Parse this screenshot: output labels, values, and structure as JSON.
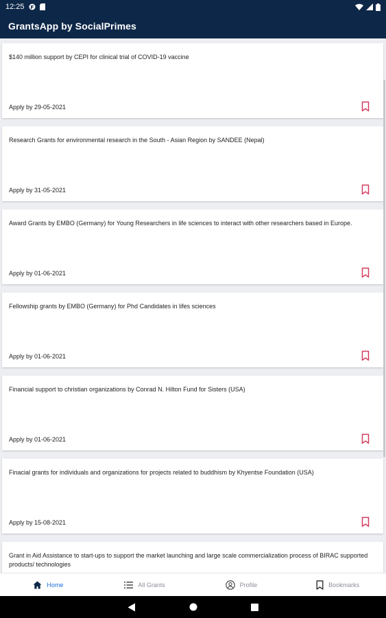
{
  "status_bar": {
    "time": "12:25"
  },
  "app_bar": {
    "title": "GrantsApp by SocialPrimes"
  },
  "grants": [
    {
      "title": "$140 million support by CEPI for clinical trial of COVID-19 vaccine",
      "apply_by": "Apply by 29-05-2021"
    },
    {
      "title": "Research Grants for environmental research in the South - Asian Region by SANDEE (Nepal)",
      "apply_by": "Apply by 31-05-2021"
    },
    {
      "title": "Award Grants by EMBO (Germany) for Young Researchers in life sciences to interact with other researchers based in Europe.",
      "apply_by": "Apply by 01-06-2021"
    },
    {
      "title": "Fellowship grants by EMBO (Germany) for Phd Candidates in lifes sciences",
      "apply_by": "Apply by 01-06-2021"
    },
    {
      "title": "Financial support to christian organizations by Conrad N. Hilton Fund for Sisters (USA)",
      "apply_by": "Apply by 01-06-2021"
    },
    {
      "title": "Finacial grants for individuals and organizations for projects related to buddhism by Khyentse Foundation (USA)",
      "apply_by": "Apply by 15-08-2021"
    },
    {
      "title": "Grant in Aid Assistance to start-ups to support the market launching and large scale commercialization process of BIRAC supported products/ technologies",
      "apply_by": ""
    }
  ],
  "bottom_nav": {
    "home": "Home",
    "all_grants": "All Grants",
    "profile": "Profile",
    "bookmarks": "Bookmarks"
  },
  "colors": {
    "app_bar": "#0d2748",
    "bookmark": "#d33b5c",
    "active_nav": "#1b6fd6",
    "inactive_nav": "#8a8f98"
  }
}
